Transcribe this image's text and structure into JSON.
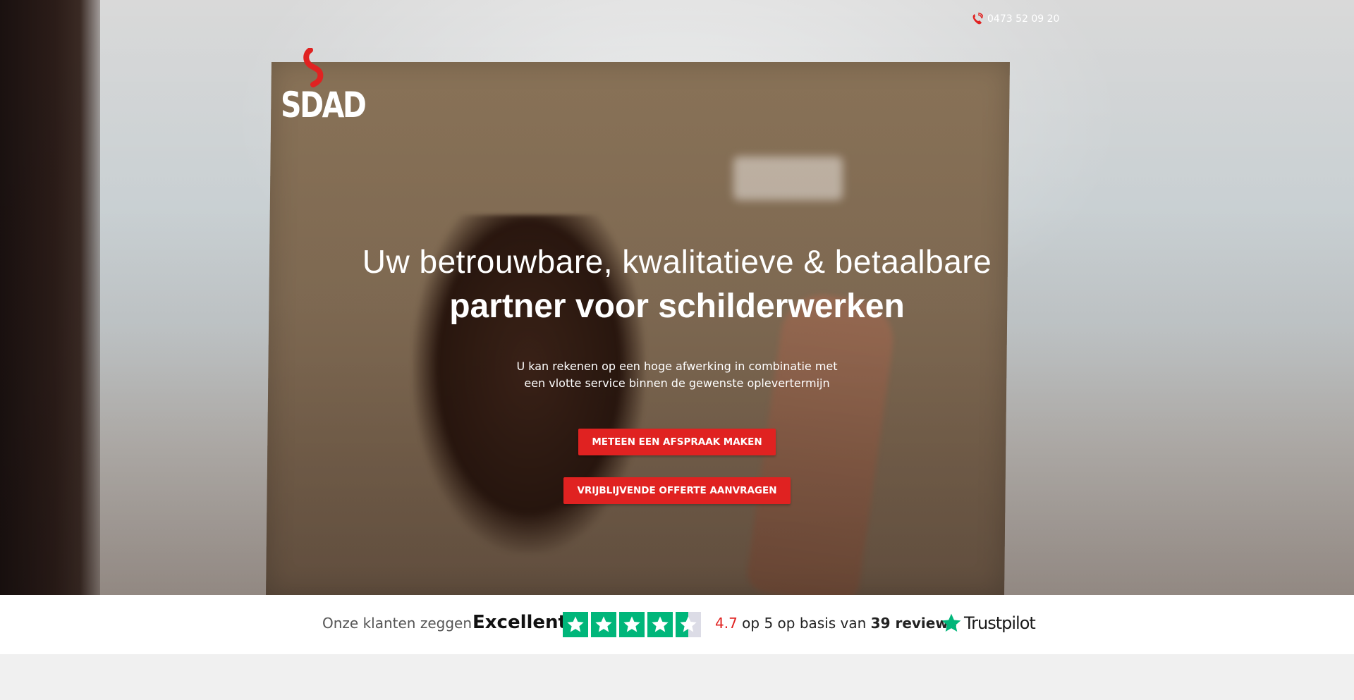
{
  "header": {
    "phone_icon": "phone-icon",
    "phone_number": "0473 52 09 20",
    "logo_text": "SDAD"
  },
  "hero": {
    "headline_line1": "Uw betrouwbare, kwalitatieve & betaalbare",
    "headline_line2": "partner voor schilderwerken",
    "subtext_line1": "U kan rekenen op een hoge afwerking in combinatie met",
    "subtext_line2": "een vlotte service binnen de gewenste oplevertermijn",
    "cta_primary": "METEEN EEN AFSPRAAK MAKEN",
    "cta_secondary": "VRIJBLIJVENDE OFFERTE AANVRAGEN"
  },
  "reviews": {
    "intro": "Onze klanten zeggen",
    "rating_word": "Excellent",
    "stars_filled": 4.5,
    "stars_total": 5,
    "score": "4.7",
    "score_suffix": "op 5 op basis van",
    "review_count": "39 reviews",
    "provider": "Trustpilot"
  },
  "colors": {
    "accent": "#e02221",
    "trustpilot_green": "#00b67a",
    "white": "#ffffff"
  }
}
